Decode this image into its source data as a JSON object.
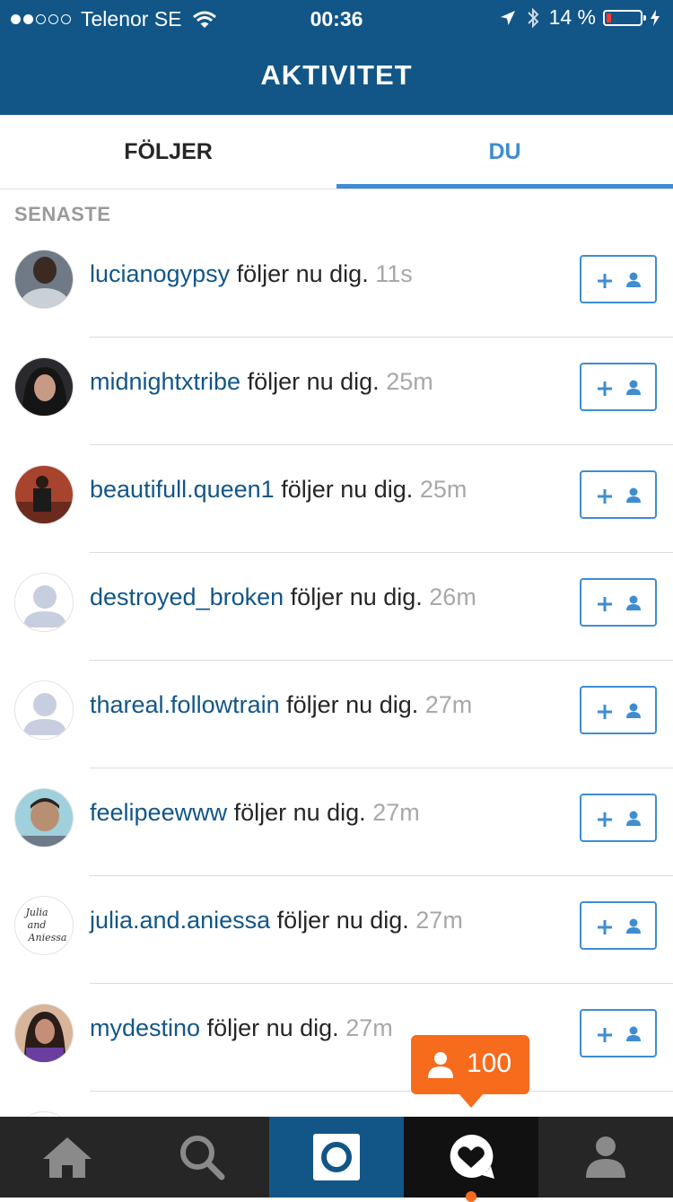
{
  "status_bar": {
    "carrier": "Telenor SE",
    "time": "00:36",
    "battery": "14 %",
    "battery_level": 0.14
  },
  "header": {
    "title": "AKTIVITET"
  },
  "tabs": [
    {
      "label": "FÖLJER",
      "active": false
    },
    {
      "label": "DU",
      "active": true
    }
  ],
  "section": {
    "label": "SENASTE"
  },
  "activity": [
    {
      "username": "lucianogypsy",
      "action": "följer nu dig.",
      "time": "11s"
    },
    {
      "username": "midnightxtribe",
      "action": "följer nu dig.",
      "time": "25m"
    },
    {
      "username": "beautifull.queen1",
      "action": "följer nu dig.",
      "time": "25m"
    },
    {
      "username": "destroyed_broken",
      "action": "följer nu dig.",
      "time": "26m"
    },
    {
      "username": "thareal.followtrain",
      "action": "följer nu dig.",
      "time": "27m"
    },
    {
      "username": "feelipeewww",
      "action": "följer nu dig.",
      "time": "27m"
    },
    {
      "username": "julia.and.aniessa",
      "action": "följer nu dig.",
      "time": "27m"
    },
    {
      "username": "mydestino",
      "action": "följer nu dig.",
      "time": "27m"
    }
  ],
  "avatar_texts": {
    "julia": [
      "Julia",
      "and",
      "Aniessa"
    ]
  },
  "notification": {
    "count": "100"
  },
  "colors": {
    "header_bg": "#125688",
    "accent": "#3f8dd1",
    "username": "#125688",
    "notification": "#f76b1c"
  },
  "tabbar": [
    "home-icon",
    "search-icon",
    "camera-icon",
    "activity-icon",
    "profile-icon"
  ]
}
